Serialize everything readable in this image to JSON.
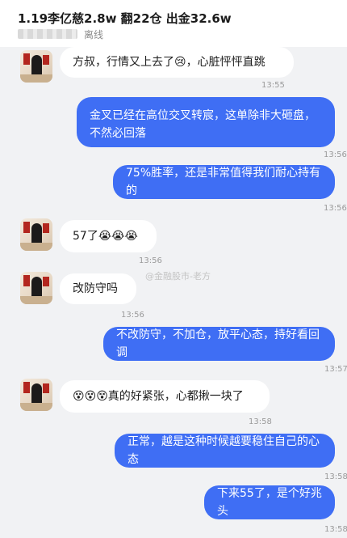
{
  "header": {
    "title": "1.19李亿慈2.8w 翻22仓 出金32.6w",
    "status": "离线"
  },
  "watermark": "@金融股市-老方",
  "messages": [
    {
      "side": "in",
      "text": "方叔，行情又上去了😢，心脏怦怦直跳",
      "time": "13:55"
    },
    {
      "side": "out",
      "text": "金叉已经在高位交叉转宸，这单除非大砸盘，不然必回落",
      "time": "13:56"
    },
    {
      "side": "out",
      "text": "75%胜率，还是非常值得我们耐心持有的",
      "time": "13:56"
    },
    {
      "side": "in",
      "text": "57了😭😭😭",
      "time": "13:56"
    },
    {
      "side": "in",
      "text": "改防守吗",
      "time": "13:56"
    },
    {
      "side": "out",
      "text": "不改防守，不加仓，放平心态，持好看回调",
      "time": "13:57"
    },
    {
      "side": "in",
      "text": "😵😵😵真的好紧张，心都揪一块了",
      "time": "13:58"
    },
    {
      "side": "out",
      "text": "正常，越是这种时候越要稳住自己的心态",
      "time": "13:58"
    },
    {
      "side": "out",
      "text": "下来55了，是个好兆头",
      "time": "13:58"
    }
  ]
}
